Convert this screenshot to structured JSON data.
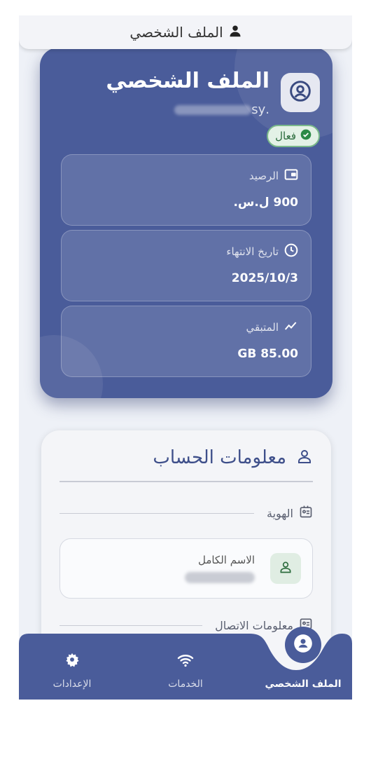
{
  "header": {
    "title": "الملف الشخصي",
    "icon": "person-icon"
  },
  "profile": {
    "name": "الملف الشخصي",
    "email_suffix": ".sy",
    "status": "فعال",
    "stats": [
      {
        "label": "الرصيد",
        "value": "900 ل.س.",
        "icon": "wallet-icon"
      },
      {
        "label": "تاريخ الانتهاء",
        "value": "2025/10/3",
        "icon": "clock-icon"
      },
      {
        "label": "المتبقي",
        "value": "GB 85.00",
        "icon": "trend-icon"
      }
    ]
  },
  "account": {
    "title": "معلومات الحساب",
    "identity_section": "الهوية",
    "full_name_label": "الاسم الكامل",
    "contact_section": "معلومات الاتصال"
  },
  "nav": {
    "profile": "الملف الشخصي",
    "services": "الخدمات",
    "settings": "الإعدادات"
  },
  "colors": {
    "primary": "#4a5c9a",
    "status_green": "#2b6b3c",
    "background": "#eef1f7"
  }
}
